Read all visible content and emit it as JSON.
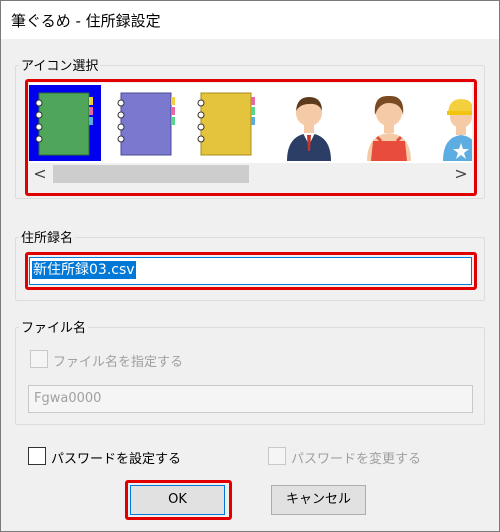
{
  "window": {
    "title": "筆ぐるめ - 住所録設定"
  },
  "icon_group": {
    "label": "アイコン選択",
    "icons": [
      {
        "name": "green-notebook-icon",
        "color": "#4fa65b"
      },
      {
        "name": "purple-notebook-icon",
        "color": "#7a78cf"
      },
      {
        "name": "yellow-notebook-icon",
        "color": "#e4c43c"
      },
      {
        "name": "businessman-icon"
      },
      {
        "name": "woman-apron-icon"
      },
      {
        "name": "child-cap-icon"
      }
    ],
    "selected_index": 0,
    "scroll_left": "<",
    "scroll_right": ">"
  },
  "address_book_name": {
    "label": "住所録名",
    "value": "新住所録03.csv"
  },
  "file_name": {
    "label": "ファイル名",
    "specify_checkbox_label": "ファイル名を指定する",
    "value": "Fgwa0000"
  },
  "password": {
    "set_label": "パスワードを設定する",
    "change_label": "パスワードを変更する"
  },
  "buttons": {
    "ok": "OK",
    "cancel": "キャンセル"
  },
  "colors": {
    "highlight_red": "#e00000",
    "selection_blue": "#0078d7",
    "selected_icon_bg": "#0000ee"
  }
}
